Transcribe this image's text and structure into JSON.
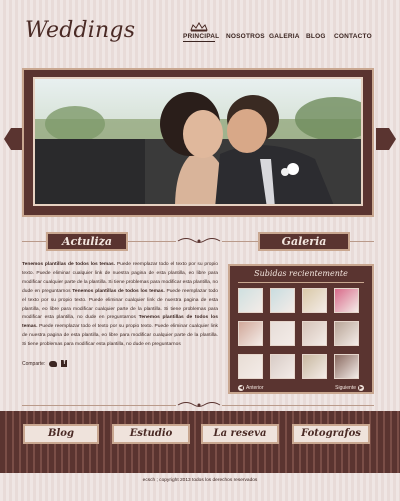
{
  "brand": {
    "logo": "Weddings"
  },
  "nav": [
    "PRINCIPAL",
    "NOSOTROS",
    "GALERIA",
    "BLOG",
    "CONTACTO"
  ],
  "sections": {
    "left_ribbon": "Actuliza",
    "right_ribbon": "Galeria"
  },
  "article": {
    "p1_bold": "Tenemos plantillas de todos los temas.",
    "p1": " Puede reemplazar todo el texto por su propio texto. Puede eliminar cualquier link de nuestra pagina de esta plantilla, eo libre para modificar cualquier parte de la plantilla. Si tiene problemas para modificar esta plantilla, no dude en preguntarnos ",
    "p1_bold2": "Tenemos plantillas de todos los temas.",
    "p2": " Puede reemplazar todo el texto por su propio texto. Puede eliminar cualquier link de nuestra pagina de esta plantilla, eo libre para modificar cualquier parte de la plantilla. Si tiene problemas para modificar esta plantilla, no dude en preguntarnos ",
    "p2_bold": "Tenemos plantillas de todos los temas.",
    "p3": " Puede reemplazar todo el texto por su propio texto. Puede eliminar cualquier link de nuestra pagina de esta plantilla, eo libre para modificar cualquier parte de la plantilla. Si tiene problemas para modificar esta plantilla, no dude en preguntarnos"
  },
  "share": {
    "label": "Comparte:"
  },
  "gallery": {
    "title": "Subidas recientemente",
    "prev": "Anterior",
    "next": "Siguiente",
    "thumb_colors": [
      "#cfe0e0",
      "#c9dde0",
      "#d9c9a8",
      "#d86a8a",
      "#d1a89a",
      "#e6ddd8",
      "#d5c3b8",
      "#b8a597",
      "#e8ddd5",
      "#d8ccc6",
      "#c8b8a0",
      "#8a6a60"
    ]
  },
  "footer": {
    "buttons": [
      "Blog",
      "Estudio",
      "La reseva",
      "Fotografos"
    ],
    "copyright": "ecsch ; copyright 2013 todos los derechos reservados"
  }
}
